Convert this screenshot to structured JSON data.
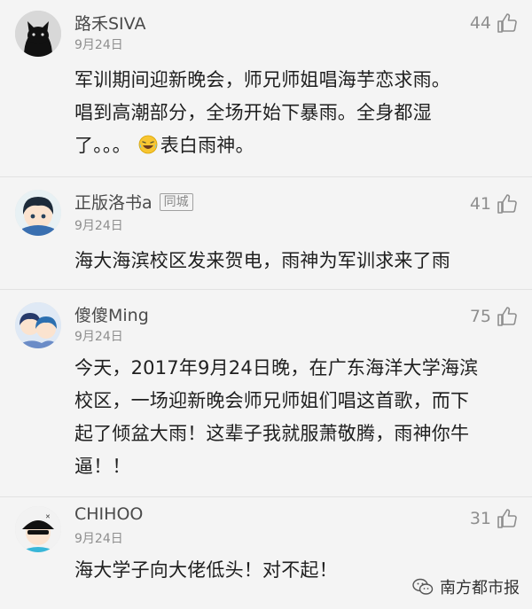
{
  "comments": [
    {
      "username": "路禾SIVA",
      "tag": "",
      "date": "9月24日",
      "likes": "44",
      "avatar_icon": "black-cat-avatar",
      "lines": [
        "军训期间迎新晚会，师兄师姐唱海芋恋求雨。",
        "唱到高潮部分，全场开始下暴雨。全身都湿",
        "了。。。"
      ],
      "line_tail": "表白雨神。",
      "emoji": "laughing-tears-emoji"
    },
    {
      "username": "正版洛书a",
      "tag": "同城",
      "date": "9月24日",
      "likes": "41",
      "avatar_icon": "anime-boy-avatar",
      "lines": [
        "海大海滨校区发来贺电，雨神为军训求来了雨"
      ]
    },
    {
      "username": "傻傻Ming",
      "tag": "",
      "date": "9月24日",
      "likes": "75",
      "avatar_icon": "anime-duo-avatar",
      "lines": [
        "今天，2017年9月24日晚，在广东海洋大学海滨",
        "校区，一场迎新晚会师兄师姐们唱这首歌，而下",
        "起了倾盆大雨！这辈子我就服萧敬腾，雨神你牛",
        "逼！！"
      ]
    },
    {
      "username": "CHIHOO",
      "tag": "",
      "date": "9月24日",
      "likes": "31",
      "avatar_icon": "cartoon-cap-avatar",
      "lines": [
        "海大学子向大佬低头！对不起！"
      ]
    }
  ],
  "watermark": {
    "text": "南方都市报",
    "icon": "wechat-icon"
  },
  "colors": {
    "background": "#f4f4f4",
    "muted": "#8e8e8e",
    "text": "#1f1f1f"
  }
}
